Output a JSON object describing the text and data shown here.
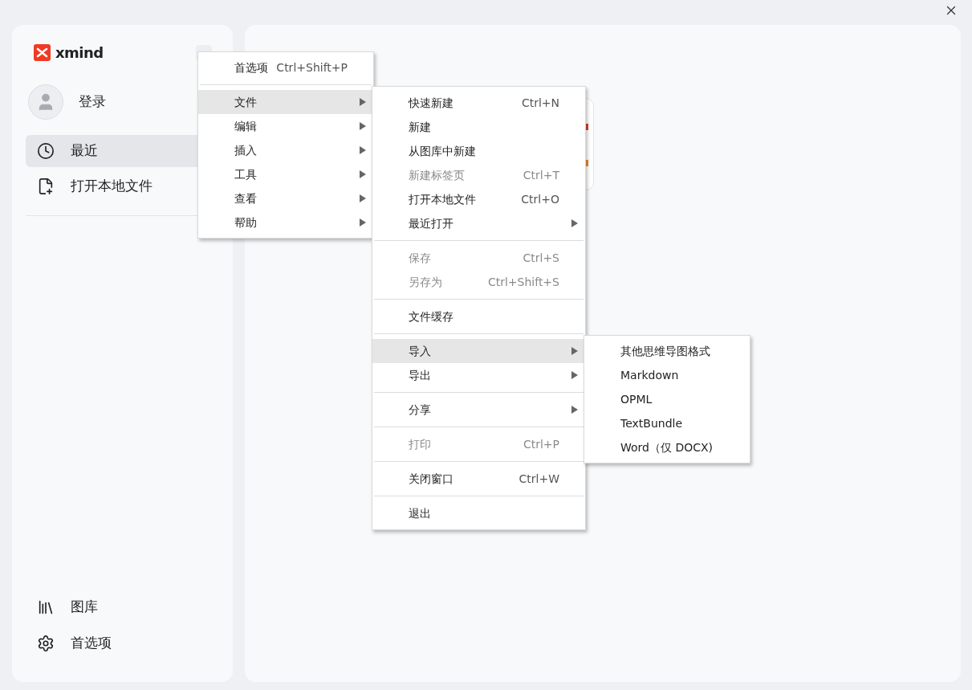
{
  "app": {
    "logo": "xmind"
  },
  "sidebar": {
    "user": {
      "label": "登录"
    },
    "nav": [
      {
        "kind": "clock",
        "label": "最近",
        "selected": true
      },
      {
        "kind": "file",
        "label": "打开本地文件",
        "selected": false
      }
    ],
    "bottom": [
      {
        "kind": "library",
        "label": "图库"
      },
      {
        "kind": "gear",
        "label": "首选项"
      }
    ]
  },
  "menus": [
    {
      "items": [
        {
          "kind": "item",
          "label": "首选项",
          "shortcut": "Ctrl+Shift+P",
          "submenu": false,
          "disabled": false,
          "selected": false
        },
        {
          "kind": "separator"
        },
        {
          "kind": "item",
          "label": "文件",
          "submenu": true,
          "disabled": false,
          "selected": true
        },
        {
          "kind": "item",
          "label": "编辑",
          "submenu": true,
          "disabled": false,
          "selected": false
        },
        {
          "kind": "item",
          "label": "插入",
          "submenu": true,
          "disabled": false,
          "selected": false
        },
        {
          "kind": "item",
          "label": "工具",
          "submenu": true,
          "disabled": false,
          "selected": false
        },
        {
          "kind": "item",
          "label": "查看",
          "submenu": true,
          "disabled": false,
          "selected": false
        },
        {
          "kind": "item",
          "label": "帮助",
          "submenu": true,
          "disabled": false,
          "selected": false
        }
      ]
    },
    {
      "items": [
        {
          "kind": "item",
          "label": "快速新建",
          "shortcut": "Ctrl+N",
          "submenu": false,
          "disabled": false,
          "selected": false
        },
        {
          "kind": "item",
          "label": "新建",
          "submenu": false,
          "disabled": false,
          "selected": false
        },
        {
          "kind": "item",
          "label": "从图库中新建",
          "submenu": false,
          "disabled": false,
          "selected": false
        },
        {
          "kind": "item",
          "label": "新建标签页",
          "shortcut": "Ctrl+T",
          "submenu": false,
          "disabled": true,
          "selected": false
        },
        {
          "kind": "item",
          "label": "打开本地文件",
          "shortcut": "Ctrl+O",
          "submenu": false,
          "disabled": false,
          "selected": false
        },
        {
          "kind": "item",
          "label": "最近打开",
          "submenu": true,
          "disabled": false,
          "selected": false
        },
        {
          "kind": "separator"
        },
        {
          "kind": "item",
          "label": "保存",
          "shortcut": "Ctrl+S",
          "submenu": false,
          "disabled": true,
          "selected": false
        },
        {
          "kind": "item",
          "label": "另存为",
          "shortcut": "Ctrl+Shift+S",
          "submenu": false,
          "disabled": true,
          "selected": false
        },
        {
          "kind": "separator"
        },
        {
          "kind": "item",
          "label": "文件缓存",
          "submenu": false,
          "disabled": false,
          "selected": false
        },
        {
          "kind": "separator"
        },
        {
          "kind": "item",
          "label": "导入",
          "submenu": true,
          "disabled": false,
          "selected": true
        },
        {
          "kind": "item",
          "label": "导出",
          "submenu": true,
          "disabled": false,
          "selected": false
        },
        {
          "kind": "separator"
        },
        {
          "kind": "item",
          "label": "分享",
          "submenu": true,
          "disabled": false,
          "selected": false
        },
        {
          "kind": "separator"
        },
        {
          "kind": "item",
          "label": "打印",
          "shortcut": "Ctrl+P",
          "submenu": false,
          "disabled": true,
          "selected": false
        },
        {
          "kind": "separator"
        },
        {
          "kind": "item",
          "label": "关闭窗口",
          "shortcut": "Ctrl+W",
          "submenu": false,
          "disabled": false,
          "selected": false
        },
        {
          "kind": "separator"
        },
        {
          "kind": "item",
          "label": "退出",
          "submenu": false,
          "disabled": false,
          "selected": false
        }
      ]
    },
    {
      "items": [
        {
          "kind": "item",
          "label": "其他思维导图格式",
          "submenu": false,
          "disabled": false,
          "selected": false
        },
        {
          "kind": "item",
          "label": "Markdown",
          "submenu": false,
          "disabled": false,
          "selected": false
        },
        {
          "kind": "item",
          "label": "OPML",
          "submenu": false,
          "disabled": false,
          "selected": false
        },
        {
          "kind": "item",
          "label": "TextBundle",
          "submenu": false,
          "disabled": false,
          "selected": false
        },
        {
          "kind": "item",
          "label": "Word（仅 DOCX)",
          "submenu": false,
          "disabled": false,
          "selected": false
        }
      ]
    }
  ]
}
